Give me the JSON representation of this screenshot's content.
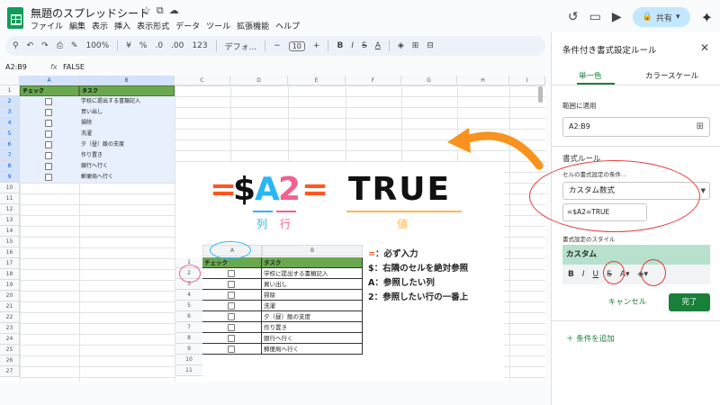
{
  "app": {
    "doc_title": "無題のスプレッドシート",
    "menu": [
      "ファイル",
      "編集",
      "表示",
      "挿入",
      "表示形式",
      "データ",
      "ツール",
      "拡張機能",
      "ヘルプ"
    ],
    "share_label": "共有"
  },
  "toolbar": {
    "zoom": "100%",
    "currency": "¥",
    "percent": "%",
    "dec_dec": ".0",
    "dec_inc": ".00",
    "num_fmt": "123",
    "font": "デフォ...",
    "font_size": "10",
    "bold": "B",
    "italic": "I",
    "strike": "S",
    "text_color": "A"
  },
  "formula_bar": {
    "name_box": "A2:B9",
    "fx": "fx",
    "value": "FALSE"
  },
  "sheet": {
    "columns": [
      "A",
      "B",
      "C",
      "D",
      "E",
      "F",
      "G",
      "H",
      "I"
    ],
    "rows": [
      "1",
      "2",
      "3",
      "4",
      "5",
      "6",
      "7",
      "8",
      "9",
      "10",
      "11",
      "12",
      "13",
      "14",
      "15",
      "16",
      "17",
      "18",
      "19",
      "20",
      "21",
      "22",
      "23",
      "24",
      "25",
      "26",
      "27"
    ],
    "header": {
      "a": "チェック",
      "b": "タスク"
    },
    "tasks": [
      "学校に提出する書類記入",
      "買い出し",
      "掃除",
      "洗濯",
      "夕（昼）飯の支度",
      "作り置き",
      "銀行へ行く",
      "郵便局へ行く"
    ]
  },
  "overlay": {
    "formula_parts": [
      "=",
      "$",
      "A",
      "2",
      "="
    ],
    "true_text": "TRUE",
    "col_label": "列",
    "row_label": "行",
    "value_label": "値",
    "legend": [
      {
        "sym": "=",
        "text": "：必ず入力"
      },
      {
        "sym": "$",
        "text": "：右隣のセルを絶対参照"
      },
      {
        "sym": "A",
        "text": "：参照したい列"
      },
      {
        "sym": "2",
        "text": "：参照したい行の一番上"
      }
    ],
    "rows": [
      "1",
      "2",
      "3",
      "4",
      "5",
      "6",
      "7",
      "8",
      "9",
      "10",
      "11"
    ],
    "col_a": "A",
    "col_b": "B"
  },
  "panel": {
    "title": "条件付き書式設定ルール",
    "tab_single": "単一色",
    "tab_scale": "カラースケール",
    "range_label": "範囲に適用",
    "range_value": "A2:B9",
    "rules_label": "書式ルール",
    "cond_label": "セルの書式設定の条件…",
    "cond_value": "カスタム数式",
    "formula_value": "=$A2=TRUE",
    "style_label": "書式設定のスタイル",
    "style_preview": "カスタム",
    "cancel": "キャンセル",
    "done": "完了",
    "add_rule": "条件を追加"
  },
  "colors": {
    "header_green": "#6aa84f",
    "accent_green": "#188038",
    "annotation_red": "#e53935",
    "arrow_orange": "#f7931e",
    "formula_blue": "#29b6f6",
    "formula_pink": "#f06292",
    "true_orange": "#ffb74d"
  }
}
